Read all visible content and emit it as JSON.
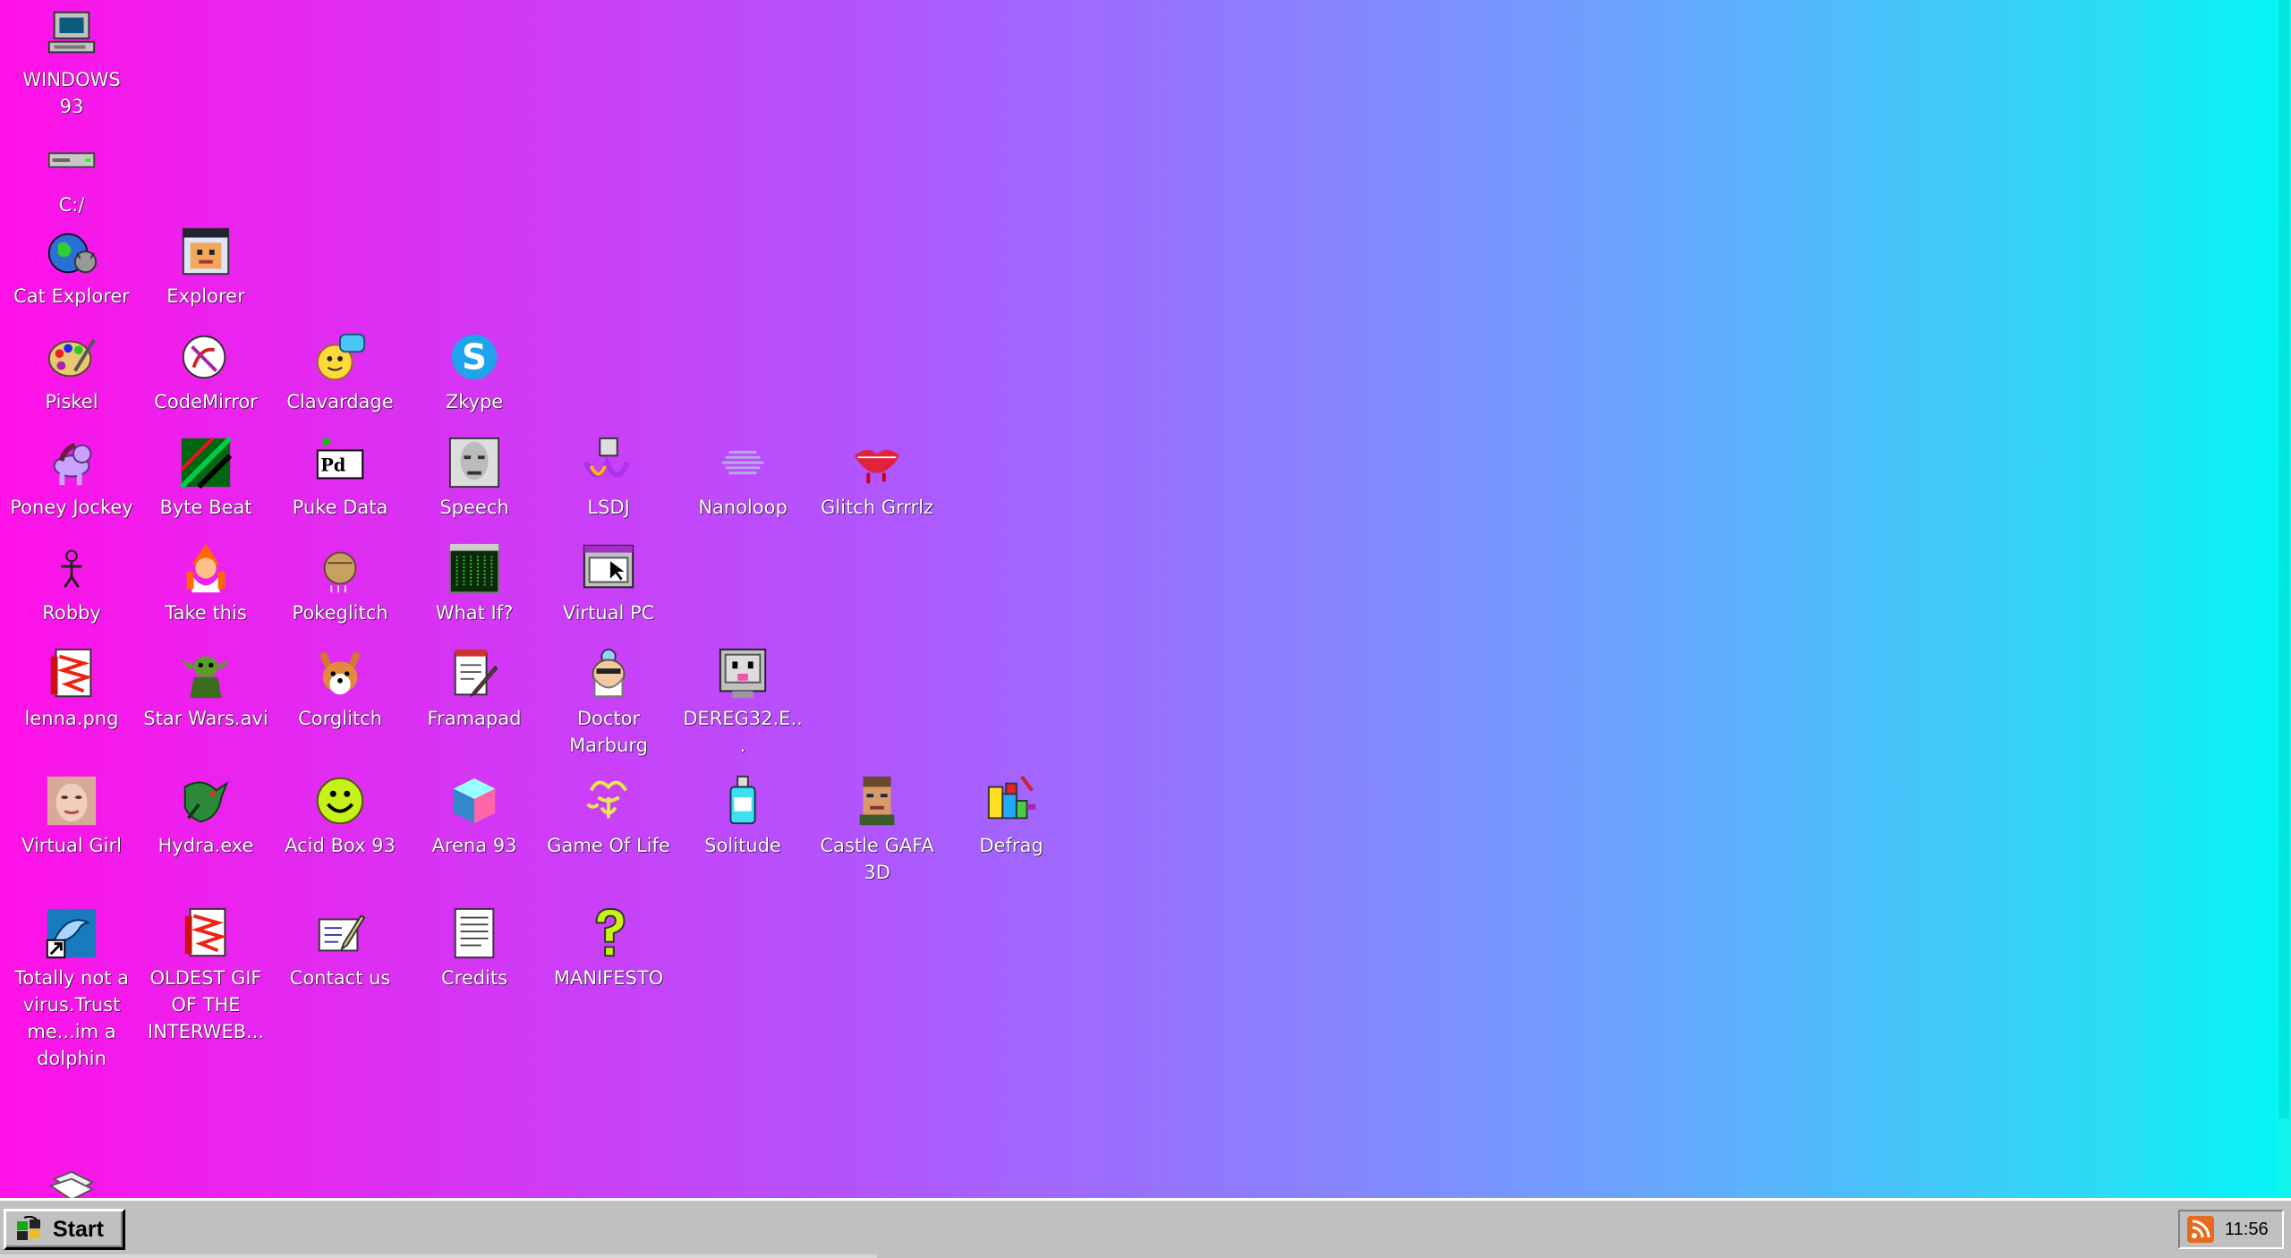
{
  "desktop": {
    "icons": [
      {
        "label": "WINDOWS 93",
        "icon": "computer-icon"
      },
      {
        "label": "C:/",
        "icon": "drive-icon"
      },
      {
        "label": "Cat Explorer",
        "icon": "cat-globe-icon"
      },
      {
        "label": "Explorer",
        "icon": "explorer-window-icon"
      },
      {
        "label": "Piskel",
        "icon": "palette-icon"
      },
      {
        "label": "CodeMirror",
        "icon": "codemirror-icon"
      },
      {
        "label": "Clavardage",
        "icon": "chat-smiley-icon"
      },
      {
        "label": "Zkype",
        "icon": "zkype-icon"
      },
      {
        "label": "Poney Jockey",
        "icon": "pony-icon"
      },
      {
        "label": "Byte Beat",
        "icon": "bytebeat-icon"
      },
      {
        "label": "Puke Data",
        "icon": "pd-flag-icon"
      },
      {
        "label": "Speech",
        "icon": "face-icon"
      },
      {
        "label": "LSDJ",
        "icon": "lsdj-icon"
      },
      {
        "label": "Nanoloop",
        "icon": "nanoloop-icon"
      },
      {
        "label": "Glitch Grrrlz",
        "icon": "lips-icon"
      },
      {
        "label": "Robby",
        "icon": "robot-stick-icon"
      },
      {
        "label": "Take this",
        "icon": "wizard-icon"
      },
      {
        "label": "Pokeglitch",
        "icon": "pokeball-icon"
      },
      {
        "label": "What If?",
        "icon": "terminal-window-icon"
      },
      {
        "label": "Virtual PC",
        "icon": "window-cursor-icon"
      },
      {
        "label": "lenna.png",
        "icon": "red-image-file-icon"
      },
      {
        "label": "Star Wars.avi",
        "icon": "yoda-icon"
      },
      {
        "label": "Corglitch",
        "icon": "corgi-icon"
      },
      {
        "label": "Framapad",
        "icon": "notepad-pen-icon"
      },
      {
        "label": "Doctor Marburg",
        "icon": "doctor-icon"
      },
      {
        "label": "DEREG32.E...",
        "icon": "monitor-face-icon"
      },
      {
        "label": "Virtual Girl",
        "icon": "girl-face-icon"
      },
      {
        "label": "Hydra.exe",
        "icon": "dragon-icon"
      },
      {
        "label": "Acid Box 93",
        "icon": "acid-smiley-icon"
      },
      {
        "label": "Arena 93",
        "icon": "cube-icon"
      },
      {
        "label": "Game Of Life",
        "icon": "life-pattern-icon"
      },
      {
        "label": "Solitude",
        "icon": "bottle-icon"
      },
      {
        "label": "Castle GAFA 3D",
        "icon": "soldier-face-icon"
      },
      {
        "label": "Defrag",
        "icon": "defrag-blocks-icon"
      },
      {
        "label": "Totally not a virus.Trust me...im a dolphin",
        "icon": "dolphin-shortcut-icon"
      },
      {
        "label": "OLDEST GIF OF THE INTERWEB...",
        "icon": "red-image-file-icon"
      },
      {
        "label": "Contact us",
        "icon": "letter-icon"
      },
      {
        "label": "Credits",
        "icon": "text-document-icon"
      },
      {
        "label": "MANIFESTO",
        "icon": "question-mark-icon"
      },
      {
        "label": "",
        "icon": "papers-icon"
      }
    ]
  },
  "taskbar": {
    "start_label": "Start",
    "clock": "11:56",
    "tray_icon": "rss-icon"
  },
  "colors": {
    "gradient_left": "#ff11e8",
    "gradient_right": "#00f7f7",
    "taskbar": "#c0c0c0"
  }
}
